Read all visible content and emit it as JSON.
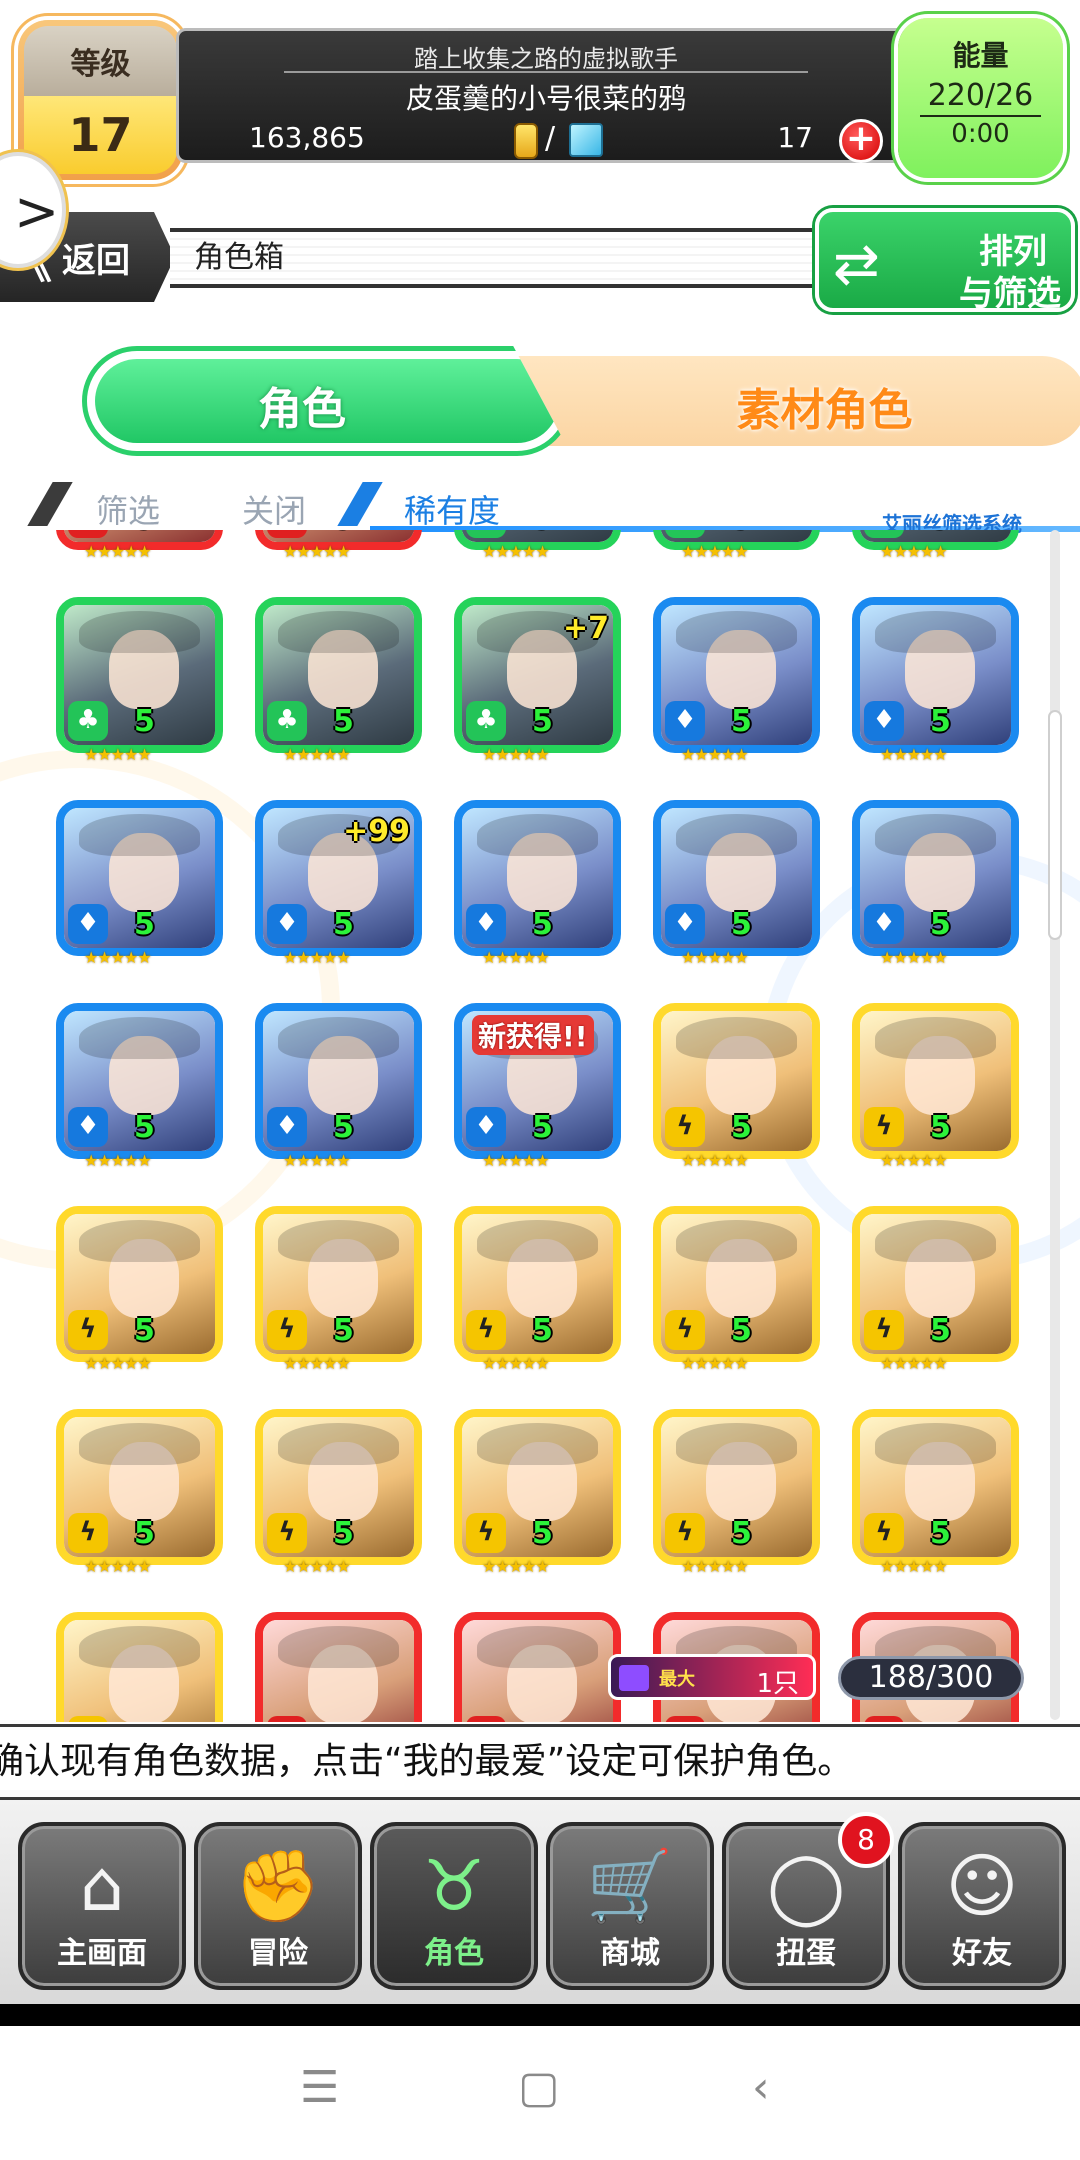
{
  "header": {
    "level_label": "等级",
    "level_value": "17",
    "title": "踏上收集之路的虚拟歌手",
    "username": "皮蛋羹的小号很菜的鸦",
    "coins": "163,865",
    "slash": "/",
    "gems": "17",
    "plus_icon": "+",
    "energy_label": "能量",
    "energy_value": "220/26",
    "energy_timer": "0:00"
  },
  "nav": {
    "back_chevron": "《",
    "back_label": "返回",
    "breadcrumb": "角色箱",
    "sort_line1": "排列",
    "sort_line2": "与筛选",
    "side_arrow": ">"
  },
  "tabs": {
    "left": "角色",
    "right": "素材角色"
  },
  "filter": {
    "filter_label": "筛选",
    "filter_state": "关闭",
    "rarity_label": "稀有度",
    "system_name": "艾丽丝筛选系统"
  },
  "stars": "★★★★★",
  "characters": [
    {
      "color": "red",
      "element": "fire-icon",
      "glyph": "▲",
      "rarity": "5",
      "plus": "",
      "new": ""
    },
    {
      "color": "red",
      "element": "fire-icon",
      "glyph": "▲",
      "rarity": "5",
      "plus": "",
      "new": ""
    },
    {
      "color": "green",
      "element": "wood-icon",
      "glyph": "♣",
      "rarity": "5",
      "plus": "",
      "new": ""
    },
    {
      "color": "green",
      "element": "wood-icon",
      "glyph": "♣",
      "rarity": "5",
      "plus": "",
      "new": ""
    },
    {
      "color": "green",
      "element": "wood-icon",
      "glyph": "♣",
      "rarity": "5",
      "plus": "",
      "new": ""
    },
    {
      "color": "green",
      "element": "wood-icon",
      "glyph": "♣",
      "rarity": "5",
      "plus": "",
      "new": ""
    },
    {
      "color": "green",
      "element": "wood-icon",
      "glyph": "♣",
      "rarity": "5",
      "plus": "",
      "new": ""
    },
    {
      "color": "green",
      "element": "wood-icon",
      "glyph": "♣",
      "rarity": "5",
      "plus": "+7",
      "new": ""
    },
    {
      "color": "blue",
      "element": "water-icon",
      "glyph": "♦",
      "rarity": "5",
      "plus": "",
      "new": ""
    },
    {
      "color": "blue",
      "element": "water-icon",
      "glyph": "♦",
      "rarity": "5",
      "plus": "",
      "new": ""
    },
    {
      "color": "blue",
      "element": "water-icon",
      "glyph": "♦",
      "rarity": "5",
      "plus": "",
      "new": ""
    },
    {
      "color": "blue",
      "element": "water-icon",
      "glyph": "♦",
      "rarity": "5",
      "plus": "+99",
      "new": ""
    },
    {
      "color": "blue",
      "element": "water-icon",
      "glyph": "♦",
      "rarity": "5",
      "plus": "",
      "new": ""
    },
    {
      "color": "blue",
      "element": "water-icon",
      "glyph": "♦",
      "rarity": "5",
      "plus": "",
      "new": ""
    },
    {
      "color": "blue",
      "element": "water-icon",
      "glyph": "♦",
      "rarity": "5",
      "plus": "",
      "new": ""
    },
    {
      "color": "blue",
      "element": "water-icon",
      "glyph": "♦",
      "rarity": "5",
      "plus": "",
      "new": ""
    },
    {
      "color": "blue",
      "element": "water-icon",
      "glyph": "♦",
      "rarity": "5",
      "plus": "",
      "new": ""
    },
    {
      "color": "blue",
      "element": "water-icon",
      "glyph": "♦",
      "rarity": "5",
      "plus": "",
      "new": "新获得!!"
    },
    {
      "color": "yellow",
      "element": "lightning-icon",
      "glyph": "ϟ",
      "rarity": "5",
      "plus": "",
      "new": ""
    },
    {
      "color": "yellow",
      "element": "lightning-icon",
      "glyph": "ϟ",
      "rarity": "5",
      "plus": "",
      "new": ""
    },
    {
      "color": "yellow",
      "element": "lightning-icon",
      "glyph": "ϟ",
      "rarity": "5",
      "plus": "",
      "new": ""
    },
    {
      "color": "yellow",
      "element": "lightning-icon",
      "glyph": "ϟ",
      "rarity": "5",
      "plus": "",
      "new": ""
    },
    {
      "color": "yellow",
      "element": "lightning-icon",
      "glyph": "ϟ",
      "rarity": "5",
      "plus": "",
      "new": ""
    },
    {
      "color": "yellow",
      "element": "lightning-icon",
      "glyph": "ϟ",
      "rarity": "5",
      "plus": "",
      "new": ""
    },
    {
      "color": "yellow",
      "element": "lightning-icon",
      "glyph": "ϟ",
      "rarity": "5",
      "plus": "",
      "new": ""
    },
    {
      "color": "yellow",
      "element": "lightning-icon",
      "glyph": "ϟ",
      "rarity": "5",
      "plus": "",
      "new": ""
    },
    {
      "color": "yellow",
      "element": "lightning-icon",
      "glyph": "ϟ",
      "rarity": "5",
      "plus": "",
      "new": ""
    },
    {
      "color": "yellow",
      "element": "lightning-icon",
      "glyph": "ϟ",
      "rarity": "5",
      "plus": "",
      "new": ""
    },
    {
      "color": "yellow",
      "element": "lightning-icon",
      "glyph": "ϟ",
      "rarity": "5",
      "plus": "",
      "new": ""
    },
    {
      "color": "yellow",
      "element": "lightning-icon",
      "glyph": "ϟ",
      "rarity": "5",
      "plus": "",
      "new": ""
    },
    {
      "color": "yellow",
      "element": "lightning-icon",
      "glyph": "ϟ",
      "rarity": "",
      "plus": "",
      "new": ""
    },
    {
      "color": "red",
      "element": "fire-icon",
      "glyph": "▲",
      "rarity": "",
      "plus": "",
      "new": ""
    },
    {
      "color": "red",
      "element": "fire-icon",
      "glyph": "▲",
      "rarity": "",
      "plus": "",
      "new": ""
    },
    {
      "color": "red",
      "element": "fire-icon",
      "glyph": "▲",
      "rarity": "",
      "plus": "",
      "new": ""
    },
    {
      "color": "red",
      "element": "fire-icon",
      "glyph": "▲",
      "rarity": "",
      "plus": "",
      "new": ""
    }
  ],
  "limit": {
    "label": "最大",
    "value": "1只"
  },
  "box_count": "188/300",
  "ticker": "确认现有角色数据，点击“我的最爱”设定可保护角色。",
  "bottom_tabs": [
    {
      "label": "主画面",
      "icon": "home-icon",
      "glyph": "⌂"
    },
    {
      "label": "冒险",
      "icon": "handshake-icon",
      "glyph": "✊"
    },
    {
      "label": "角色",
      "icon": "rabbit-icon",
      "glyph": "♉"
    },
    {
      "label": "商城",
      "icon": "cart-icon",
      "glyph": "🛒"
    },
    {
      "label": "扭蛋",
      "icon": "egg-icon",
      "glyph": "◯"
    },
    {
      "label": "好友",
      "icon": "friends-icon",
      "glyph": "☺"
    }
  ],
  "gacha_notification": "8",
  "system_nav": {
    "menu": "☰",
    "home": "▢",
    "back": "‹"
  },
  "colors": {
    "green": "#25d35a",
    "blue": "#1a8af0",
    "yellow": "#ffd92b",
    "red": "#f22b2b",
    "tab_active": "#7df08a",
    "accent_orange": "#ff8a17"
  }
}
